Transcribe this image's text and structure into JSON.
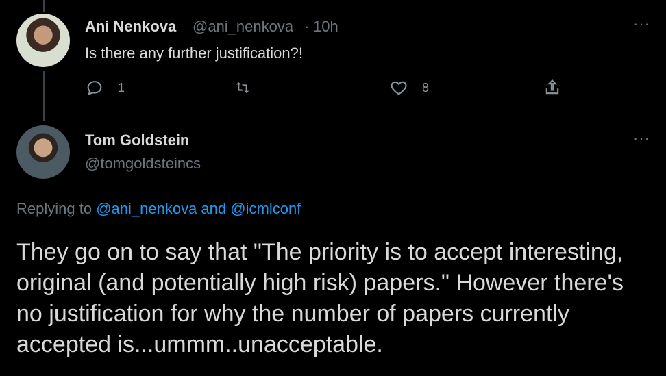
{
  "reply_tweet": {
    "author_name": "Ani Nenkova",
    "author_handle": "@ani_nenkova",
    "separator": "·",
    "time": "10h",
    "text": "Is there any further justification?!",
    "reply_count": "1",
    "retweet_count": "",
    "like_count": "8",
    "more_label": "···"
  },
  "main_tweet": {
    "author_name": "Tom Goldstein",
    "author_handle": "@tomgoldsteincs",
    "more_label": "···",
    "replying_prefix": "Replying to",
    "replying_user1": "@ani_nenkova",
    "replying_and": "and",
    "replying_user2": "@icmlconf",
    "text": "They go on to say that \"The priority is to accept interesting, original (and potentially high risk) papers.\" However there's no justification for why the number of papers currently accepted is...ummm..unacceptable."
  },
  "colors": {
    "background": "#000000",
    "link": "#1d9bf0",
    "muted": "#6e767d"
  }
}
